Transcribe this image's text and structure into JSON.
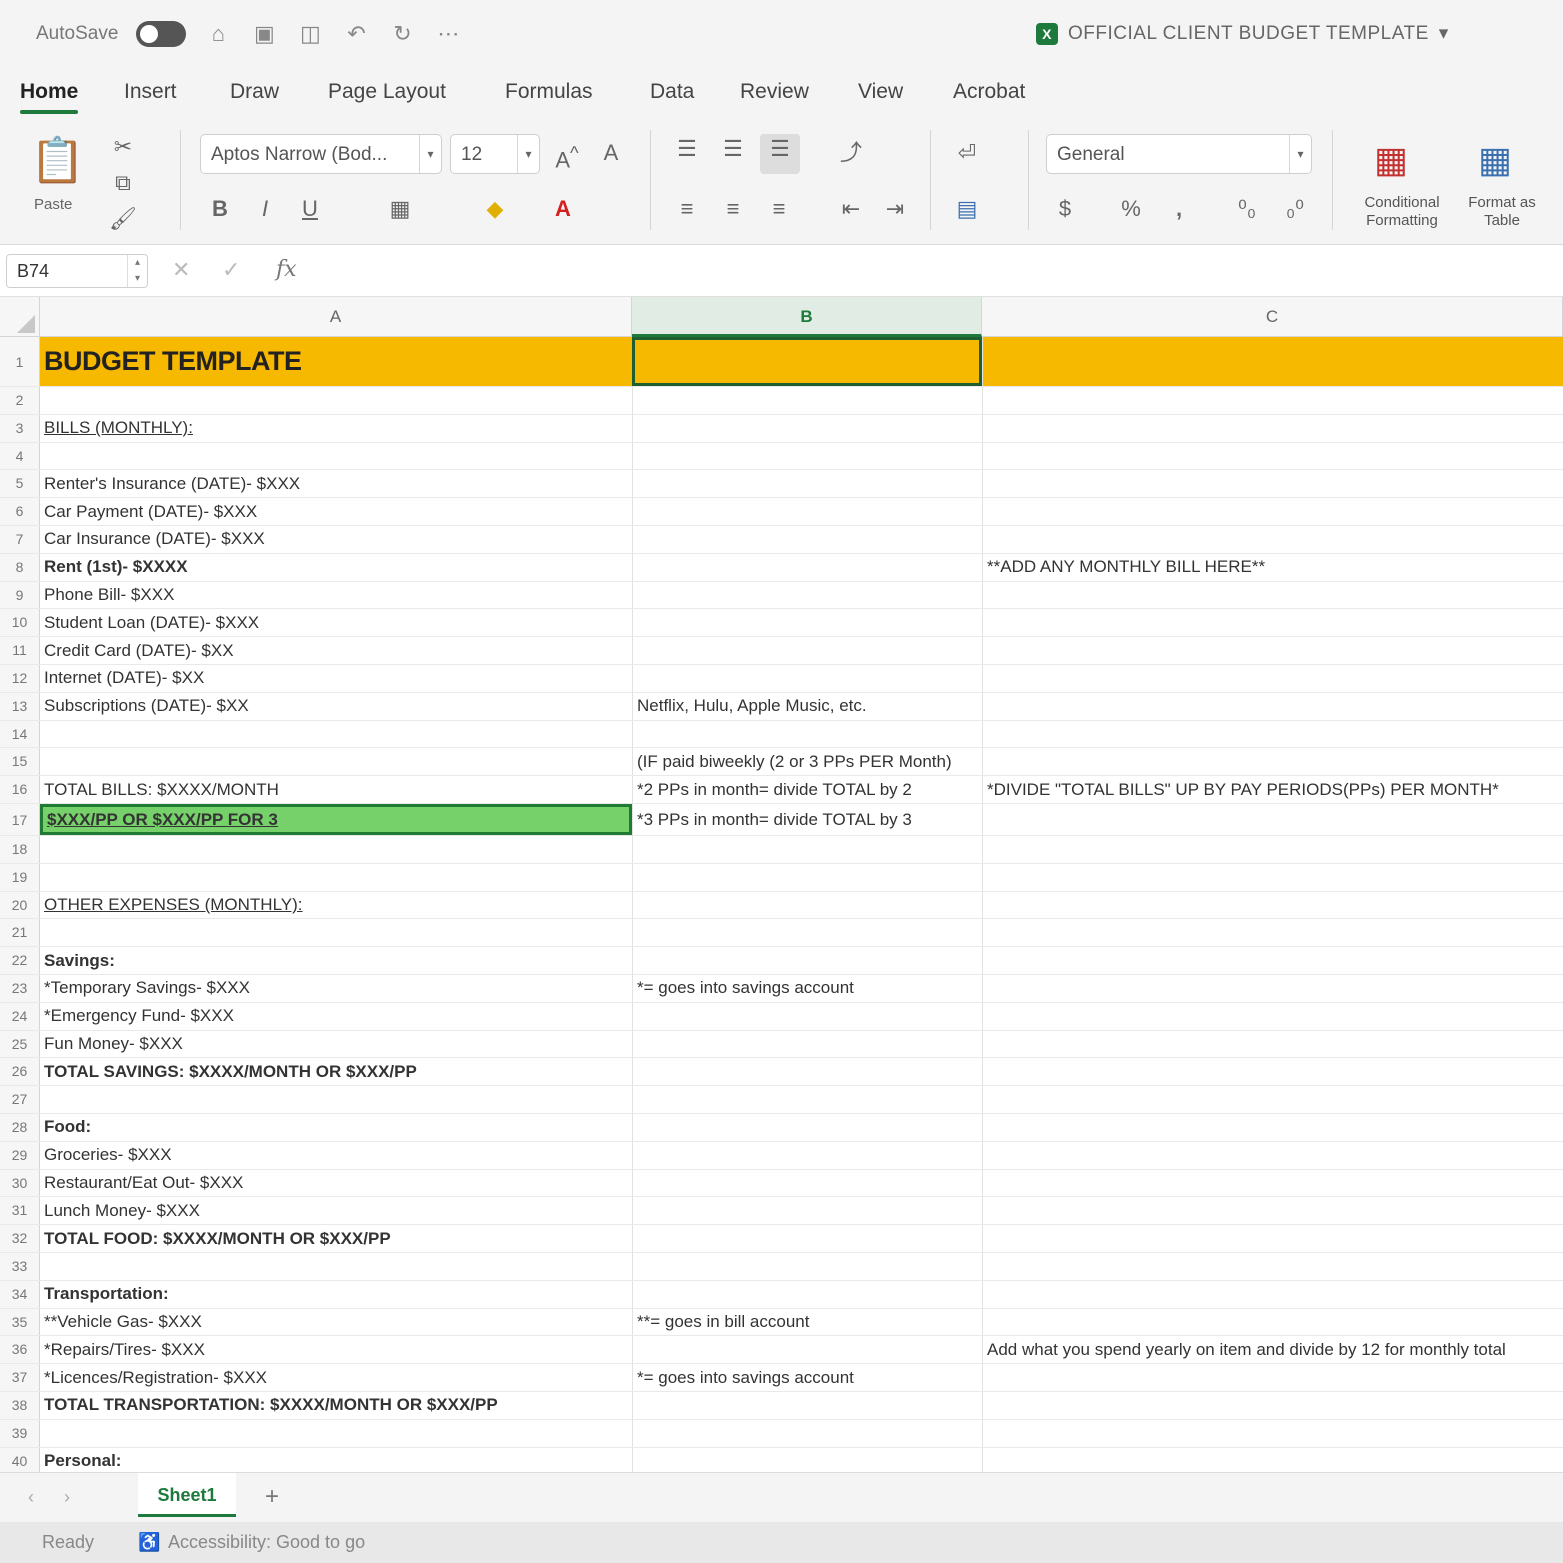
{
  "titlebar": {
    "autosave_label": "AutoSave",
    "doc_title": "OFFICIAL CLIENT BUDGET TEMPLATE",
    "doc_title_caret": "▾"
  },
  "tabs": [
    "Home",
    "Insert",
    "Draw",
    "Page Layout",
    "Formulas",
    "Data",
    "Review",
    "View",
    "Acrobat"
  ],
  "ribbon": {
    "paste_label": "Paste",
    "font_name": "Aptos Narrow (Bod...",
    "font_size": "12",
    "number_format": "General",
    "conditional_formatting": "Conditional Formatting",
    "format_as_table": "Format as Table"
  },
  "formula_bar": {
    "name_box": "B74",
    "fx": "fx"
  },
  "columns": [
    "A",
    "B",
    "C"
  ],
  "rows": [
    {
      "n": "1",
      "a": "BUDGET TEMPLATE",
      "b": "",
      "c": ""
    },
    {
      "n": "2",
      "a": "",
      "b": "",
      "c": ""
    },
    {
      "n": "3",
      "a": "BILLS (MONTHLY):",
      "b": "",
      "c": ""
    },
    {
      "n": "4",
      "a": "",
      "b": "",
      "c": ""
    },
    {
      "n": "5",
      "a": "Renter's Insurance (DATE)- $XXX",
      "b": "",
      "c": ""
    },
    {
      "n": "6",
      "a": "Car Payment (DATE)- $XXX",
      "b": "",
      "c": ""
    },
    {
      "n": "7",
      "a": "Car Insurance (DATE)- $XXX",
      "b": "",
      "c": ""
    },
    {
      "n": "8",
      "a": "Rent (1st)- $XXXX",
      "b": "",
      "c": "**ADD ANY MONTHLY BILL HERE**"
    },
    {
      "n": "9",
      "a": "Phone Bill- $XXX",
      "b": "",
      "c": ""
    },
    {
      "n": "10",
      "a": "Student Loan (DATE)- $XXX",
      "b": "",
      "c": ""
    },
    {
      "n": "11",
      "a": "Credit Card (DATE)- $XX",
      "b": "",
      "c": ""
    },
    {
      "n": "12",
      "a": "Internet (DATE)- $XX",
      "b": "",
      "c": ""
    },
    {
      "n": "13",
      "a": "Subscriptions (DATE)- $XX",
      "b": "Netflix, Hulu, Apple Music, etc.",
      "c": ""
    },
    {
      "n": "14",
      "a": "",
      "b": "",
      "c": ""
    },
    {
      "n": "15",
      "a": "",
      "b": "(IF paid biweekly (2 or 3 PPs PER Month)",
      "c": ""
    },
    {
      "n": "16",
      "a": "TOTAL BILLS: $XXXX/MONTH",
      "b": "*2 PPs in month= divide TOTAL by 2",
      "c": "*DIVIDE \"TOTAL BILLS\" UP BY PAY PERIODS(PPs) PER MONTH*"
    },
    {
      "n": "17",
      "a": "$XXX/PP OR $XXX/PP FOR 3",
      "b": "*3 PPs in month= divide TOTAL by 3",
      "c": ""
    },
    {
      "n": "18",
      "a": "",
      "b": "",
      "c": ""
    },
    {
      "n": "19",
      "a": "",
      "b": "",
      "c": ""
    },
    {
      "n": "20",
      "a": "OTHER EXPENSES (MONTHLY):",
      "b": "",
      "c": ""
    },
    {
      "n": "21",
      "a": "",
      "b": "",
      "c": ""
    },
    {
      "n": "22",
      "a": "Savings:",
      "b": "",
      "c": ""
    },
    {
      "n": "23",
      "a": "*Temporary Savings- $XXX",
      "b": "*= goes into savings account",
      "c": ""
    },
    {
      "n": "24",
      "a": "*Emergency Fund- $XXX",
      "b": "",
      "c": ""
    },
    {
      "n": "25",
      "a": "Fun Money- $XXX",
      "b": "",
      "c": ""
    },
    {
      "n": "26",
      "a": "TOTAL SAVINGS: $XXXX/MONTH OR $XXX/PP",
      "b": "",
      "c": ""
    },
    {
      "n": "27",
      "a": "",
      "b": "",
      "c": ""
    },
    {
      "n": "28",
      "a": "Food:",
      "b": "",
      "c": ""
    },
    {
      "n": "29",
      "a": "Groceries- $XXX",
      "b": "",
      "c": ""
    },
    {
      "n": "30",
      "a": "Restaurant/Eat Out- $XXX",
      "b": "",
      "c": ""
    },
    {
      "n": "31",
      "a": "Lunch Money- $XXX",
      "b": "",
      "c": ""
    },
    {
      "n": "32",
      "a": "TOTAL FOOD: $XXXX/MONTH OR $XXX/PP",
      "b": "",
      "c": ""
    },
    {
      "n": "33",
      "a": "",
      "b": "",
      "c": ""
    },
    {
      "n": "34",
      "a": "Transportation:",
      "b": "",
      "c": ""
    },
    {
      "n": "35",
      "a": "**Vehicle Gas- $XXX",
      "b": "**= goes in bill account",
      "c": ""
    },
    {
      "n": "36",
      "a": "*Repairs/Tires- $XXX",
      "b": "",
      "c": "Add what you spend yearly on item and divide by 12 for monthly total"
    },
    {
      "n": "37",
      "a": "*Licences/Registration- $XXX",
      "b": "*= goes into savings account",
      "c": ""
    },
    {
      "n": "38",
      "a": "TOTAL TRANSPORTATION: $XXXX/MONTH OR $XXX/PP",
      "b": "",
      "c": ""
    },
    {
      "n": "39",
      "a": "",
      "b": "",
      "c": ""
    },
    {
      "n": "40",
      "a": "Personal:",
      "b": "",
      "c": ""
    }
  ],
  "sheets": {
    "active": "Sheet1",
    "add_label": "+"
  },
  "status": {
    "ready": "Ready",
    "accessibility": "Accessibility: Good to go"
  },
  "colors": {
    "title_fill": "#f7b800",
    "highlight_fill": "#77d16b",
    "excel_green": "#1d7a3c"
  }
}
